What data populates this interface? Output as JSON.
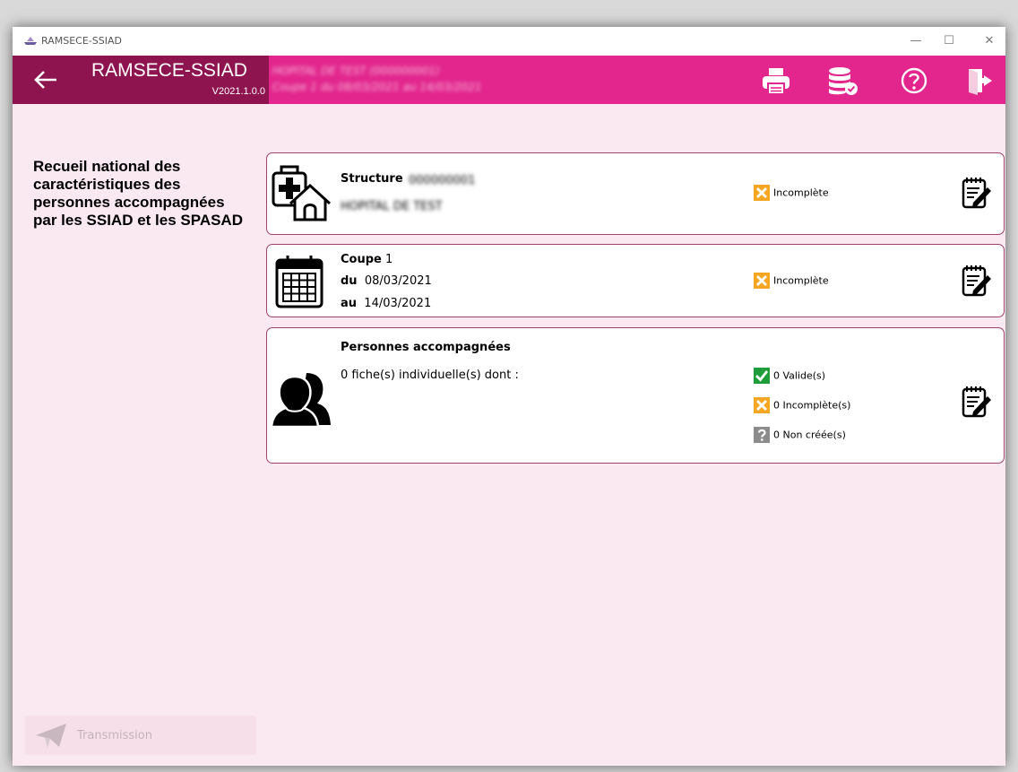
{
  "window": {
    "title": "RAMSECE-SSIAD",
    "controls": {
      "minimize": "—",
      "maximize": "☐",
      "close": "✕"
    }
  },
  "header": {
    "app_name": "RAMSECE-SSIAD",
    "version": "V2021.1.0.0",
    "hospital_line1": "HOPITAL DE TEST (000000001)",
    "hospital_line2": "Coupe 1 du 08/03/2021 au 14/03/2021",
    "icons": [
      "back-arrow-icon",
      "printer-icon",
      "database-check-icon",
      "help-icon",
      "exit-icon"
    ]
  },
  "intro": "Recueil national des caractéristiques des personnes accompagnées par les SSIAD et les SPASAD",
  "cards": {
    "structure": {
      "label": "Structure",
      "id": "000000001",
      "name": "HOPITAL DE TEST",
      "status": "Incomplète"
    },
    "coupe": {
      "label": "Coupe",
      "number": "1",
      "from_label": "du",
      "from_date": "08/03/2021",
      "to_label": "au",
      "to_date": "14/03/2021",
      "status": "Incomplète"
    },
    "personnes": {
      "label": "Personnes accompagnées",
      "summary": "0 fiche(s) individuelle(s) dont :",
      "valid": "0 Valide(s)",
      "incomplete": "0 Incomplète(s)",
      "not_created": "0 Non créée(s)"
    }
  },
  "footer": {
    "transmission_label": "Transmission"
  },
  "colors": {
    "header_pink": "#e2268d",
    "header_dark": "#8e1450",
    "background": "#fbe9f1",
    "status_orange": "#f5a623",
    "status_green": "#1f9d3a",
    "status_grey": "#8c8c8c"
  }
}
